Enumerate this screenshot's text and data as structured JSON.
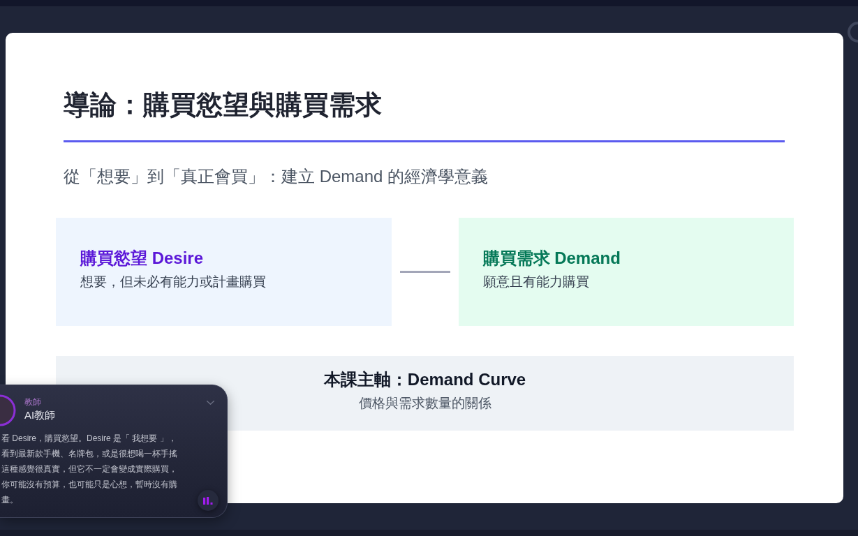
{
  "slide": {
    "title": "導論：購買慾望與購買需求",
    "subtitle": "從「想要」到「真正會買」：建立 Demand 的經濟學意義",
    "concepts": [
      {
        "kind": "desire",
        "heading": "購買慾望 Desire",
        "description": "想要，但未必有能力或計畫購買"
      },
      {
        "kind": "demand",
        "heading": "購買需求 Demand",
        "description": "願意且有能力購買"
      }
    ],
    "focus": {
      "heading": "本課主軸：Demand Curve",
      "caption": "價格與需求數量的關係"
    }
  },
  "tutor_panel": {
    "role": "教師",
    "name": "AI教師",
    "message_lines": [
      "看 Desire，購買慾望。Desire 是「 我想要 」，",
      "看到最新款手機、名牌包，或是很想喝一杯手搖",
      "這種感覺很真實，但它不一定會變成實際購買，",
      "你可能沒有預算，也可能只是心想，暫時沒有購",
      "畫。"
    ]
  }
}
